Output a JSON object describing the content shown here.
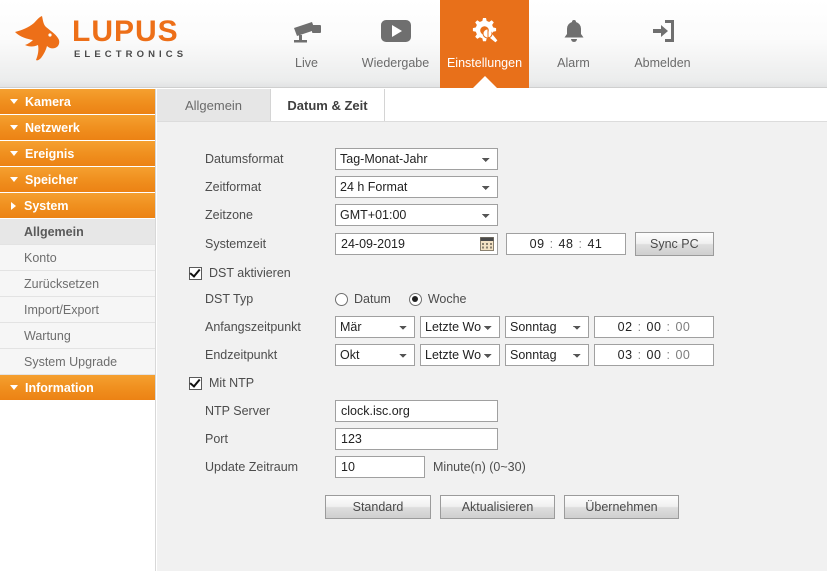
{
  "brand": {
    "name": "LUPUS",
    "tagline": "ELECTRONICS",
    "accent": "#ED6F18",
    "logo_icon": "wolf-head-icon"
  },
  "nav": {
    "items": [
      {
        "label": "Live",
        "icon": "camera-icon",
        "active": false
      },
      {
        "label": "Wiedergabe",
        "icon": "play-icon",
        "active": false
      },
      {
        "label": "Einstellungen",
        "icon": "settings-gear-wrench-icon",
        "active": true
      },
      {
        "label": "Alarm",
        "icon": "bell-icon",
        "active": false
      },
      {
        "label": "Abmelden",
        "icon": "logout-icon",
        "active": false
      }
    ]
  },
  "sidebar": {
    "groups": [
      {
        "label": "Kamera",
        "expanded": false
      },
      {
        "label": "Netzwerk",
        "expanded": false
      },
      {
        "label": "Ereignis",
        "expanded": false
      },
      {
        "label": "Speicher",
        "expanded": false
      },
      {
        "label": "System",
        "expanded": true
      }
    ],
    "system_items": [
      {
        "label": "Allgemein",
        "active": true
      },
      {
        "label": "Konto",
        "active": false
      },
      {
        "label": "Zurücksetzen",
        "active": false
      },
      {
        "label": "Import/Export",
        "active": false
      },
      {
        "label": "Wartung",
        "active": false
      },
      {
        "label": "System Upgrade",
        "active": false
      }
    ],
    "information": {
      "label": "Information",
      "expanded": false
    }
  },
  "tabs": [
    {
      "label": "Allgemein",
      "active": false
    },
    {
      "label": "Datum & Zeit",
      "active": true
    }
  ],
  "form": {
    "date_format": {
      "label": "Datumsformat",
      "value": "Tag-Monat-Jahr"
    },
    "time_format": {
      "label": "Zeitformat",
      "value": "24 h Format"
    },
    "timezone": {
      "label": "Zeitzone",
      "value": "GMT+01:00"
    },
    "system_time": {
      "label": "Systemzeit",
      "date": "24-09-2019",
      "hour": "09",
      "minute": "48",
      "second": "41",
      "separator": ":",
      "calendar_icon": "calendar-icon",
      "sync_button": "Sync PC"
    },
    "dst_enable": {
      "label": "DST aktivieren",
      "checked": true
    },
    "dst_type": {
      "label": "DST Typ",
      "options": [
        {
          "label": "Datum",
          "selected": false
        },
        {
          "label": "Woche",
          "selected": true
        }
      ]
    },
    "dst_start": {
      "label": "Anfangszeitpunkt",
      "month": "Mär",
      "week": "Letzte Wo",
      "day": "Sonntag",
      "hour": "02",
      "minute": "00",
      "second": "00"
    },
    "dst_end": {
      "label": "Endzeitpunkt",
      "month": "Okt",
      "week": "Letzte Wo",
      "day": "Sonntag",
      "hour": "03",
      "minute": "00",
      "second": "00"
    },
    "ntp_enable": {
      "label": "Mit NTP",
      "checked": true
    },
    "ntp_server": {
      "label": "NTP Server",
      "value": "clock.isc.org"
    },
    "ntp_port": {
      "label": "Port",
      "value": "123"
    },
    "ntp_interval": {
      "label": "Update Zeitraum",
      "value": "10",
      "hint": "Minute(n) (0~30)"
    },
    "buttons": {
      "default": "Standard",
      "refresh": "Aktualisieren",
      "apply": "Übernehmen"
    }
  }
}
